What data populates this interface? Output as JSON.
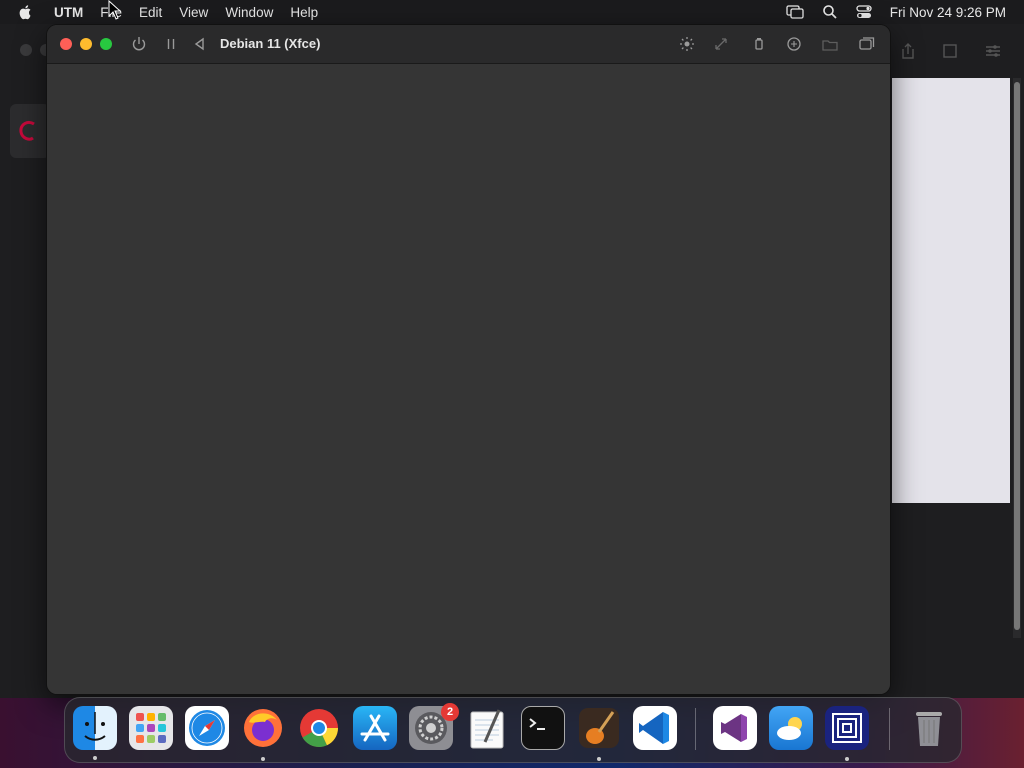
{
  "menubar": {
    "app_name": "UTM",
    "items": [
      "File",
      "Edit",
      "View",
      "Window",
      "Help"
    ],
    "clock": "Fri Nov 24  9:26 PM",
    "status_icons": [
      "screen-mirroring-icon",
      "spotlight-search-icon",
      "control-center-icon"
    ]
  },
  "vm_window": {
    "title": "Debian 11 (Xfce)",
    "toolbar_left": [
      "power-icon",
      "pause-icon",
      "back-icon"
    ],
    "toolbar_right": [
      "display-brightness-icon",
      "resize-icon",
      "usb-icon",
      "shared-folder-icon",
      "cd-drive-icon",
      "windows-icon"
    ]
  },
  "background_window": {
    "toolbar_icons": [
      "share-icon",
      "stop-icon",
      "settings-sliders-icon"
    ]
  },
  "dock": {
    "apps": [
      {
        "name": "Finder",
        "icon": "finder-icon",
        "running": true
      },
      {
        "name": "Launchpad",
        "icon": "launchpad-icon",
        "running": false
      },
      {
        "name": "Safari",
        "icon": "safari-icon",
        "running": false
      },
      {
        "name": "Firefox",
        "icon": "firefox-icon",
        "running": true
      },
      {
        "name": "Google Chrome",
        "icon": "chrome-icon",
        "running": false
      },
      {
        "name": "App Store",
        "icon": "app-store-icon",
        "running": false
      },
      {
        "name": "System Settings",
        "icon": "system-settings-icon",
        "running": false,
        "badge": "2"
      },
      {
        "name": "TextEdit",
        "icon": "textedit-icon",
        "running": false
      },
      {
        "name": "Terminal",
        "icon": "terminal-icon",
        "running": false
      },
      {
        "name": "GarageBand",
        "icon": "garageband-icon",
        "running": true
      },
      {
        "name": "Visual Studio Code",
        "icon": "vscode-icon",
        "running": false
      },
      {
        "name": "Visual Studio",
        "icon": "visual-studio-icon",
        "running": false
      },
      {
        "name": "Weather",
        "icon": "weather-icon",
        "running": false
      },
      {
        "name": "UTM",
        "icon": "utm-icon",
        "running": true
      },
      {
        "name": "Trash",
        "icon": "trash-icon",
        "running": false
      }
    ]
  },
  "colors": {
    "menubar_bg": "#1b1b1d",
    "vm_screen_bg": "#353535",
    "close": "#ff5f57",
    "minimize": "#febc2e",
    "maximize": "#28c840",
    "badge": "#e53935"
  }
}
